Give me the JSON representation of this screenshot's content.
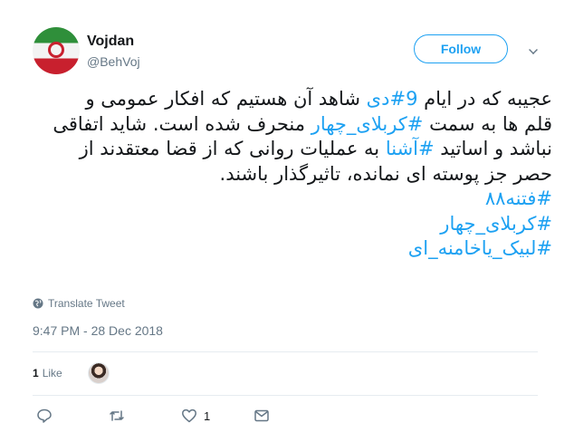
{
  "user": {
    "display_name": "Vojdan",
    "handle": "@BehVoj",
    "follow_label": "Follow"
  },
  "tweet": {
    "lines": [
      [
        {
          "t": "عجیبه که در ایام "
        },
        {
          "t": "9#دی",
          "hl": true
        },
        {
          "t": " شاهد آن هستیم که افکار عمومی و"
        }
      ],
      [
        {
          "t": "قلم ها به سمت "
        },
        {
          "t": "#کربلای_چهار",
          "hl": true
        },
        {
          "t": " منحرف شده است. شاید اتفاقی"
        }
      ],
      [
        {
          "t": "نباشد و اساتید "
        },
        {
          "t": "#آشنا",
          "hl": true
        },
        {
          "t": " به عملیات روانی که از قضا معتقدند از"
        }
      ],
      [
        {
          "t": "حصر جز پوسته ای نمانده، تاثیرگذار باشند."
        }
      ],
      [
        {
          "t": "#فتنه۸۸",
          "hl": true
        }
      ],
      [
        {
          "t": "#کربلای_چهار",
          "hl": true
        }
      ],
      [
        {
          "t": "#لبیک_یاخامنه_ای",
          "hl": true
        }
      ]
    ]
  },
  "translate_label": "Translate Tweet",
  "timestamp": "9:47 PM - 28 Dec 2018",
  "stats": {
    "likes_count": "1",
    "likes_label": "Like"
  },
  "actions": {
    "like_count": "1"
  },
  "colors": {
    "accent": "#1da1f2",
    "secondary_text": "#657786",
    "divider": "#e6ecf0"
  },
  "icons": [
    "globe-icon",
    "caret-down-icon",
    "reply-icon",
    "retweet-icon",
    "heart-icon",
    "message-icon"
  ]
}
